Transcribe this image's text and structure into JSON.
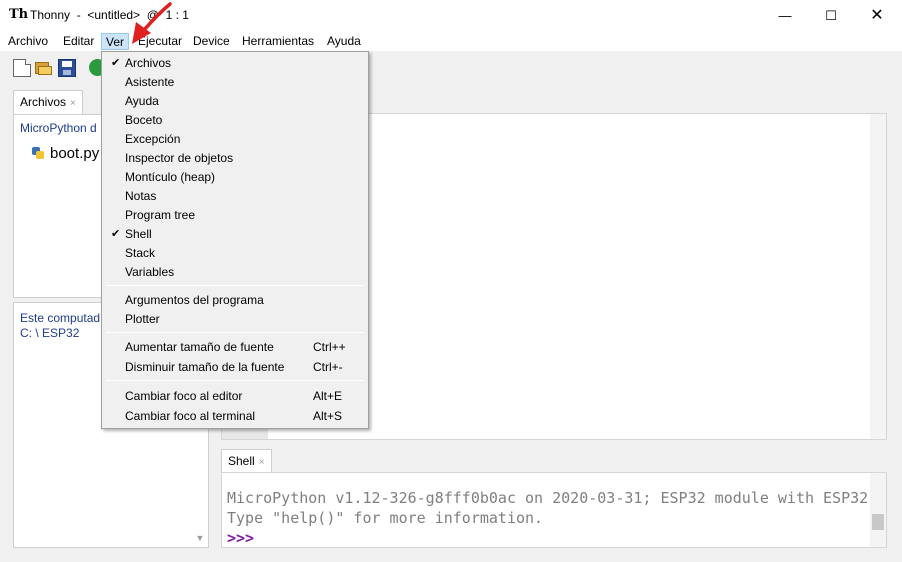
{
  "window": {
    "app_icon": "Th",
    "title": "Thonny  -  <untitled>  @  1 : 1",
    "min_glyph": "—",
    "max_glyph": "☐",
    "close_glyph": "✕"
  },
  "menubar": [
    "Archivo",
    "Editar",
    "Ver",
    "Ejecutar",
    "Device",
    "Herramientas",
    "Ayuda"
  ],
  "left": {
    "files_tab": "Archivos",
    "tab_close": "×",
    "device_title": "MicroPython d",
    "file": "boot.py",
    "computer_title": "Este computad",
    "computer_path": "C: \\ ESP32",
    "scroll_down": "▼"
  },
  "shell": {
    "tab": "Shell",
    "tab_close": "×",
    "line1": "MicroPython v1.12-326-g8fff0b0ac on 2020-03-31; ESP32 module with ESP32",
    "line2": "Type \"help()\" for more information.",
    "prompt": ">>>"
  },
  "view_menu": {
    "check_glyph": "✔",
    "items": [
      {
        "label": "Archivos",
        "checked": true
      },
      {
        "label": "Asistente",
        "checked": false
      },
      {
        "label": "Ayuda",
        "checked": false
      },
      {
        "label": "Boceto",
        "checked": false
      },
      {
        "label": "Excepción",
        "checked": false
      },
      {
        "label": "Inspector de objetos",
        "checked": false
      },
      {
        "label": "Montículo (heap)",
        "checked": false
      },
      {
        "label": "Notas",
        "checked": false
      },
      {
        "label": "Program tree",
        "checked": false
      },
      {
        "label": "Shell",
        "checked": true
      },
      {
        "label": "Stack",
        "checked": false
      },
      {
        "label": "Variables",
        "checked": false
      },
      {
        "label": "Argumentos del programa",
        "checked": false
      },
      {
        "label": "Plotter",
        "checked": false
      },
      {
        "label": "Aumentar tamaño de fuente",
        "accel": "Ctrl++"
      },
      {
        "label": "Disminuir tamaño de la fuente",
        "accel": "Ctrl+-"
      },
      {
        "label": "Cambiar foco al editor",
        "accel": "Alt+E"
      },
      {
        "label": "Cambiar foco al terminal",
        "accel": "Alt+S"
      }
    ]
  },
  "colors": {
    "accent_blue": "#1f3c8c",
    "menu_highlight": "#cce4f7",
    "annotation_arrow": "#e02020",
    "prompt": "#7a1e9e"
  }
}
